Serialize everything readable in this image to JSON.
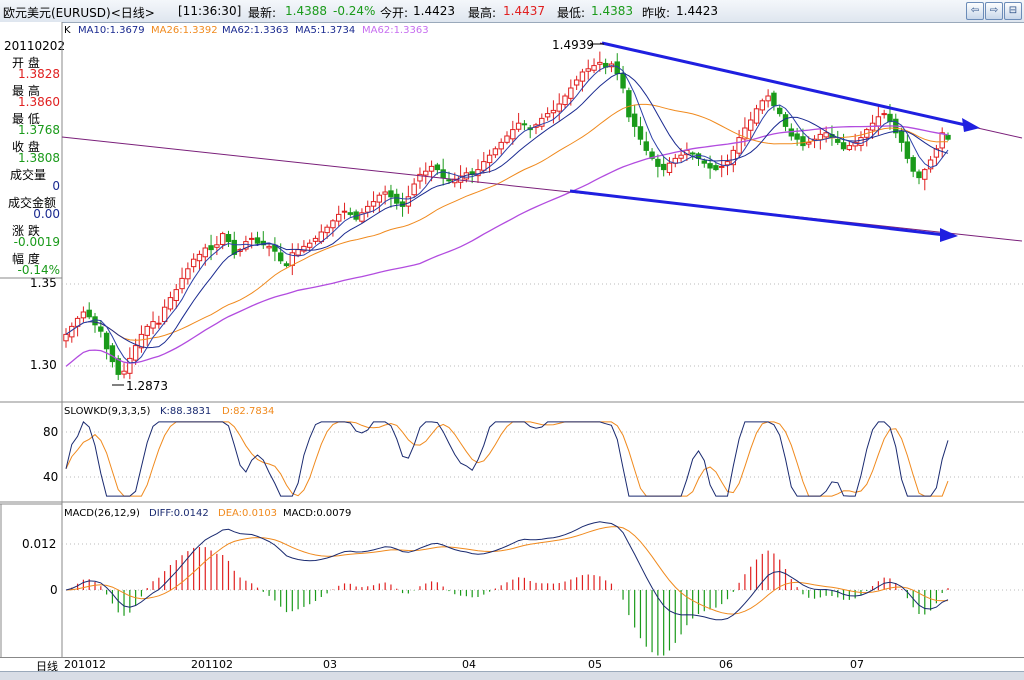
{
  "header": {
    "symbol": "欧元美元(EURUSD)<日线>",
    "time": "[11:36:30]",
    "latest_label": "最新:",
    "latest_value": "1.4388",
    "change": "-0.24%",
    "open_label": "今开:",
    "open_value": "1.4423",
    "high_label": "最高:",
    "high_value": "1.4437",
    "low_label": "最低:",
    "low_value": "1.4383",
    "prev_label": "昨收:",
    "prev_value": "1.4423"
  },
  "left_panel": {
    "date": "20110202",
    "open_label": "开  盘",
    "open_value": "1.3828",
    "high_label": "最  高",
    "high_value": "1.3860",
    "low_label": "最  低",
    "low_value": "1.3768",
    "close_label": "收  盘",
    "close_value": "1.3808",
    "volume_label": "成交量",
    "volume_value": "0",
    "amount_label": "成交金额",
    "amount_value": "0.00",
    "change_label": "涨  跌",
    "change_value": "-0.0019",
    "pct_label": "幅  度",
    "pct_value": "-0.14%"
  },
  "colors": {
    "up": "#e02020",
    "down": "#1a9a1a",
    "ma10": "#1a2a90",
    "ma26": "#f08a1e",
    "ma62": "#b24cdf",
    "trend": "#1f1fe0",
    "channel": "#7a1f7a",
    "k_line": "#1a2a70",
    "d_line": "#f08a1e"
  },
  "main_panel": {
    "legend": [
      "K",
      "MA10:1.3679",
      "MA26:1.3392",
      "MA62:1.3363",
      "MA5:1.3734",
      "MA62:1.3363"
    ],
    "y_ticks": [
      "1.35",
      "1.30"
    ],
    "annotations": {
      "high": "1.4939",
      "low": "1.2873"
    }
  },
  "stoch_panel": {
    "legend": [
      "SLOWKD(9,3,3,5)",
      "K:88.3831",
      "D:82.7834"
    ],
    "y_ticks": [
      "80",
      "40"
    ]
  },
  "macd_panel": {
    "legend": [
      "MACD(26,12,9)",
      "DIFF:0.0142",
      "DEA:0.0103",
      "MACD:0.0079"
    ],
    "y_ticks": [
      "0.012",
      "0"
    ]
  },
  "date_axis": {
    "label": "日线",
    "ticks": [
      "201012",
      "201102",
      "03",
      "04",
      "05",
      "06",
      "07"
    ]
  },
  "chart_data": {
    "type": "candlestick",
    "title": "欧元美元(EURUSD)<日线>",
    "y_range_main": [
      1.28,
      1.5
    ],
    "high_point": 1.4939,
    "low_point": 1.2873,
    "closes": [
      1.316,
      1.321,
      1.326,
      1.33,
      1.327,
      1.322,
      1.318,
      1.307,
      1.299,
      1.291,
      1.293,
      1.301,
      1.309,
      1.316,
      1.321,
      1.324,
      1.323,
      1.333,
      1.339,
      1.344,
      1.351,
      1.357,
      1.363,
      1.366,
      1.37,
      1.369,
      1.372,
      1.379,
      1.374,
      1.366,
      1.369,
      1.374,
      1.376,
      1.373,
      1.372,
      1.371,
      1.368,
      1.362,
      1.359,
      1.367,
      1.369,
      1.371,
      1.373,
      1.376,
      1.38,
      1.383,
      1.387,
      1.391,
      1.393,
      1.391,
      1.388,
      1.392,
      1.396,
      1.399,
      1.403,
      1.405,
      1.402,
      1.398,
      1.396,
      1.402,
      1.41,
      1.416,
      1.418,
      1.421,
      1.419,
      1.414,
      1.412,
      1.413,
      1.415,
      1.417,
      1.416,
      1.419,
      1.424,
      1.428,
      1.432,
      1.436,
      1.44,
      1.444,
      1.448,
      1.447,
      1.444,
      1.447,
      1.451,
      1.454,
      1.456,
      1.46,
      1.465,
      1.47,
      1.475,
      1.48,
      1.482,
      1.484,
      1.486,
      1.483,
      1.485,
      1.479,
      1.47,
      1.452,
      1.446,
      1.438,
      1.431,
      1.426,
      1.421,
      1.419,
      1.423,
      1.426,
      1.428,
      1.431,
      1.429,
      1.426,
      1.423,
      1.42,
      1.419,
      1.421,
      1.424,
      1.431,
      1.439,
      1.445,
      1.45,
      1.457,
      1.462,
      1.465,
      1.459,
      1.454,
      1.446,
      1.44,
      1.438,
      1.434,
      1.436,
      1.438,
      1.441,
      1.442,
      1.439,
      1.436,
      1.432,
      1.434,
      1.436,
      1.439,
      1.444,
      1.448,
      1.452,
      1.454,
      1.449,
      1.442,
      1.436,
      1.426,
      1.418,
      1.414,
      1.419,
      1.425,
      1.432,
      1.442,
      1.438
    ],
    "series": [
      {
        "name": "MA10",
        "value": 1.3679
      },
      {
        "name": "MA26",
        "value": 1.3392
      },
      {
        "name": "MA62",
        "value": 1.3363
      },
      {
        "name": "MA5",
        "value": 1.3734
      }
    ],
    "slowkd": {
      "K": 88.3831,
      "D": 82.7834
    },
    "macd": {
      "DIFF": 0.0142,
      "DEA": 0.0103,
      "MACD": 0.0079
    },
    "x_ticks": [
      "201012",
      "201102",
      "03",
      "04",
      "05",
      "06",
      "07"
    ]
  }
}
